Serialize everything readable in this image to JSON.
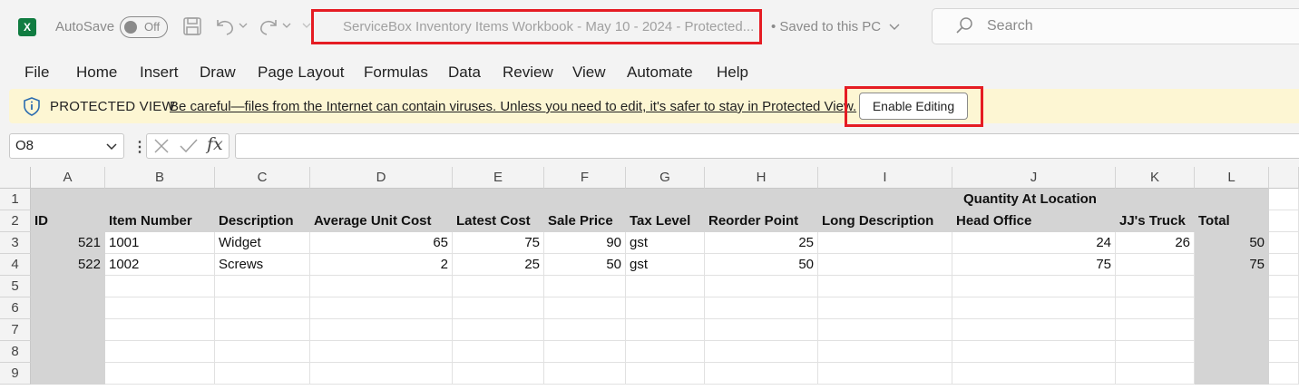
{
  "titlebar": {
    "app_icon_letter": "X",
    "autosave_label": "AutoSave",
    "autosave_state": "Off",
    "title": "ServiceBox Inventory Items Workbook - May 10 - 2024  -  Protected...",
    "saved_status": "• Saved to this PC",
    "search_placeholder": "Search"
  },
  "menu": [
    "File",
    "Home",
    "Insert",
    "Draw",
    "Page Layout",
    "Formulas",
    "Data",
    "Review",
    "View",
    "Automate",
    "Help"
  ],
  "protected_view": {
    "title": "PROTECTED VIEW",
    "message": "Be careful—files from the Internet can contain viruses. Unless you need to edit, it's safer to stay in Protected View.",
    "button_label": "Enable Editing"
  },
  "formula_bar": {
    "name_box": "O8",
    "fx": "fx",
    "formula": ""
  },
  "sheet": {
    "columns": [
      "A",
      "B",
      "C",
      "D",
      "E",
      "F",
      "G",
      "H",
      "I",
      "J",
      "K",
      "L"
    ],
    "rows": [
      "1",
      "2",
      "3",
      "4",
      "5",
      "6",
      "7",
      "8",
      "9"
    ],
    "group_header": "Quantity At Location",
    "headers": [
      "ID",
      "Item Number",
      "Description",
      "Average Unit Cost",
      "Latest Cost",
      "Sale Price",
      "Tax Level",
      "Reorder Point",
      "Long Description",
      "Head Office",
      "JJ's Truck",
      "Total"
    ],
    "data": [
      [
        "521",
        "1001",
        "Widget",
        "65",
        "75",
        "90",
        "gst",
        "25",
        "",
        "24",
        "26",
        "50"
      ],
      [
        "522",
        "1002",
        "Screws",
        "2",
        "25",
        "50",
        "gst",
        "50",
        "",
        "75",
        "",
        "75"
      ]
    ],
    "header_fill": "#d4d4d4"
  }
}
